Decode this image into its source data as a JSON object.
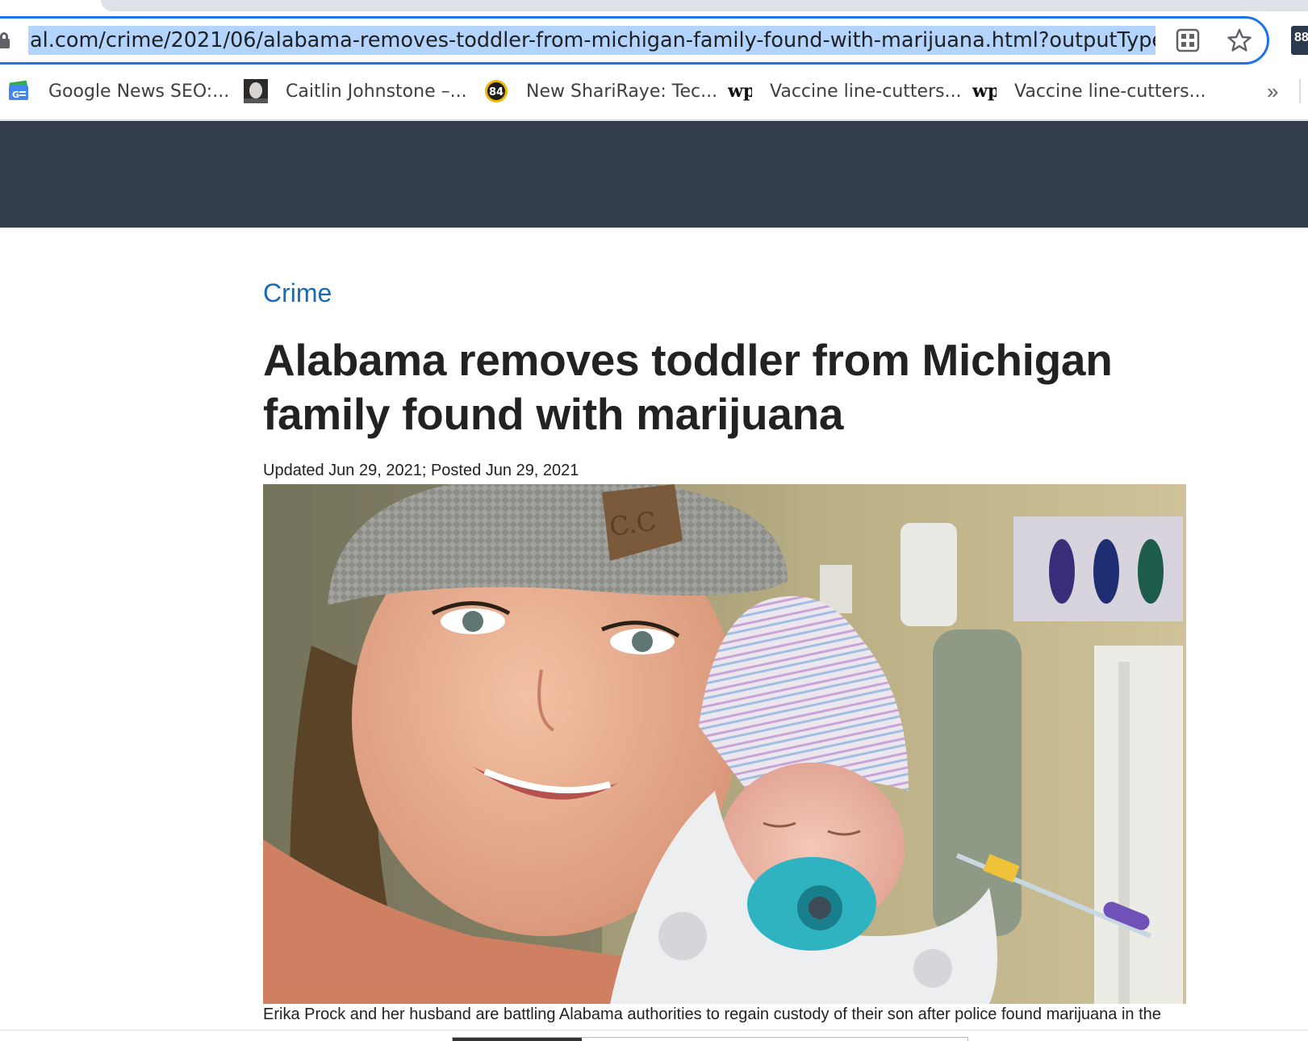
{
  "browser": {
    "url": "al.com/crime/2021/06/alabama-removes-toddler-from-michigan-family-found-with-marijuana.html?outputType=",
    "extension_badge": "88",
    "bookmarks": [
      {
        "label": "Google News SEO:...",
        "icon": "google-news-icon"
      },
      {
        "label": "Caitlin Johnstone –...",
        "icon": "avatar-icon"
      },
      {
        "label": "New ShariRaye: Tec...",
        "icon": "eighty-four-icon"
      },
      {
        "label": "Vaccine line-cutters...",
        "icon": "washington-post-icon"
      },
      {
        "label": "Vaccine line-cutters...",
        "icon": "washington-post-icon"
      }
    ],
    "bookmarks_more": "»"
  },
  "article": {
    "category": "Crime",
    "headline": "Alabama removes toddler from Michigan family found with marijuana",
    "dateline": "Updated Jun 29, 2021; Posted Jun 29, 2021",
    "caption": "Erika Prock and her husband are battling Alabama authorities to regain custody of their son after police found marijuana in the",
    "photo_hat_patch": "C.C"
  },
  "colors": {
    "header_bg": "#333c49",
    "category": "#1a6bb5",
    "selection": "#b3d4fc",
    "focus_ring": "#1a73e8"
  }
}
